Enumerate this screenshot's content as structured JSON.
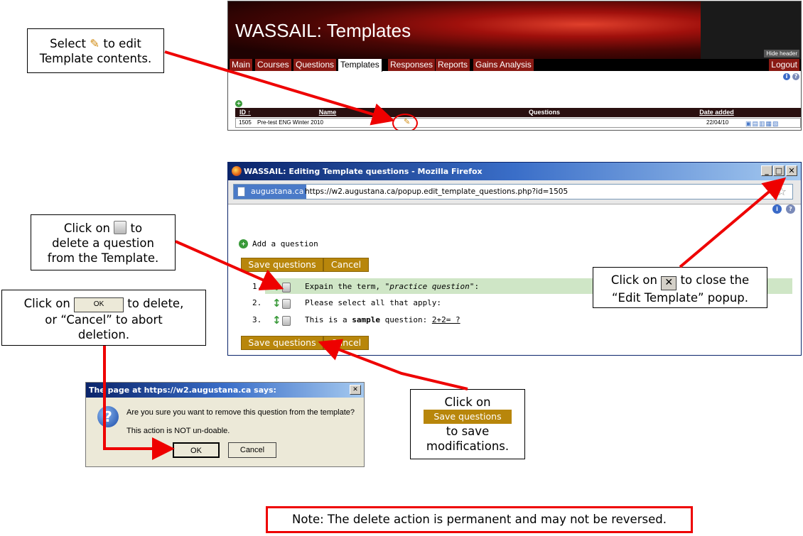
{
  "templates_panel": {
    "title": "WASSAIL: Templates",
    "hide_header": "Hide header",
    "tabs": [
      "Main",
      "Courses",
      "Questions",
      "Templates",
      "Responses",
      "Reports",
      "Gains Analysis"
    ],
    "logout": "Logout",
    "columns": {
      "id": "ID ↑",
      "name": "Name",
      "questions": "Questions",
      "date_added": "Date added"
    },
    "row": {
      "id": "1505",
      "name": "Pre-test ENG Winter 2010",
      "date": "22/04/10"
    }
  },
  "popup": {
    "window_title": "WASSAIL: Editing Template questions - Mozilla Firefox",
    "domain": "augustana.ca",
    "url": "https://w2.augustana.ca/popup.edit_template_questions.php?id=1505",
    "add_question": "Add a question",
    "save_label": "Save questions",
    "cancel_label": "Cancel",
    "questions": [
      {
        "num": "1.",
        "pre": "Expain the term, ",
        "em": "\"practice question\"",
        "post": ":"
      },
      {
        "num": "2.",
        "text": "Please select all that apply:"
      },
      {
        "num": "3.",
        "pre": "This is a ",
        "strong": "sample",
        "mid": " question: ",
        "link": "2+2= ?"
      }
    ]
  },
  "dialog": {
    "title": "The page at https://w2.augustana.ca says:",
    "message": "Are you sure you want to remove this question from the template?",
    "submessage": "This action is NOT un-doable.",
    "ok": "OK",
    "cancel": "Cancel",
    "close": "✕"
  },
  "callouts": {
    "edit": {
      "pre": "Select",
      "post": "to edit",
      "line2": "Template contents."
    },
    "delete_question": {
      "pre": "Click on",
      "post": "to",
      "line2": "delete a question",
      "line3": "from the Template."
    },
    "confirm": {
      "pre": "Click on",
      "ok": "OK",
      "post": "to delete,",
      "line2": "or “Cancel” to abort",
      "line3": "deletion."
    },
    "close": {
      "pre": "Click on",
      "post": "to close the",
      "line2": "“Edit Template” popup."
    },
    "save": {
      "line1": "Click on",
      "button": "Save questions",
      "line3": "to save",
      "line4": "modifications."
    }
  },
  "note": "Note: The delete action is permanent and may not be reversed.",
  "colors": {
    "arrow": "#ee0000",
    "gold": "#b8860b",
    "tab": "#8a1a14",
    "highlight_row": "#cfe6c6"
  }
}
